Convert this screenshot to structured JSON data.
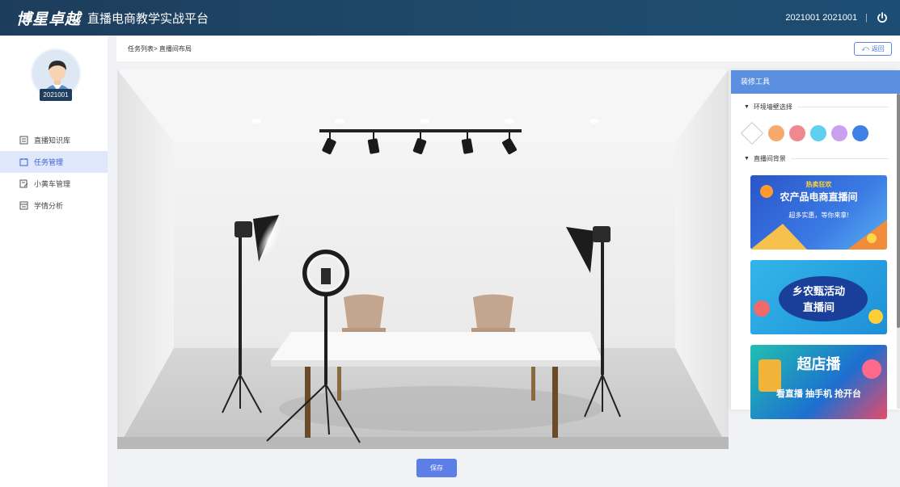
{
  "header": {
    "logo": "博星卓越",
    "title": "直播电商教学实战平台",
    "user": "2021001 2021001",
    "separator": "|"
  },
  "sidebar": {
    "avatar_id": "2021001",
    "items": [
      {
        "label": "直播知识库",
        "icon": "book-icon",
        "active": false
      },
      {
        "label": "任务管理",
        "icon": "task-icon",
        "active": true
      },
      {
        "label": "小黄车管理",
        "icon": "cart-icon",
        "active": false
      },
      {
        "label": "学情分析",
        "icon": "chart-icon",
        "active": false
      }
    ]
  },
  "breadcrumb": "任务列表> 直播间布局",
  "back_button": "返回",
  "panel": {
    "title": "装修工具",
    "wall_section": "环境墙壁选择",
    "bg_section": "直播间背景",
    "colors": [
      "#ffffff",
      "#f5a96b",
      "#f0888f",
      "#5fd0f0",
      "#c9a1ee",
      "#3f80e6"
    ],
    "backgrounds": [
      {
        "line1": "热卖狂欢",
        "line2": "农产品电商直播间",
        "line3": "超多实惠，等你来拿!"
      },
      {
        "line1": "乡农甄活动",
        "line2": "直播间"
      },
      {
        "line1": "超店播",
        "line2": "看直播 抽手机 抢开台"
      }
    ]
  },
  "save_button": "保存",
  "accent": "#5b7fe6"
}
